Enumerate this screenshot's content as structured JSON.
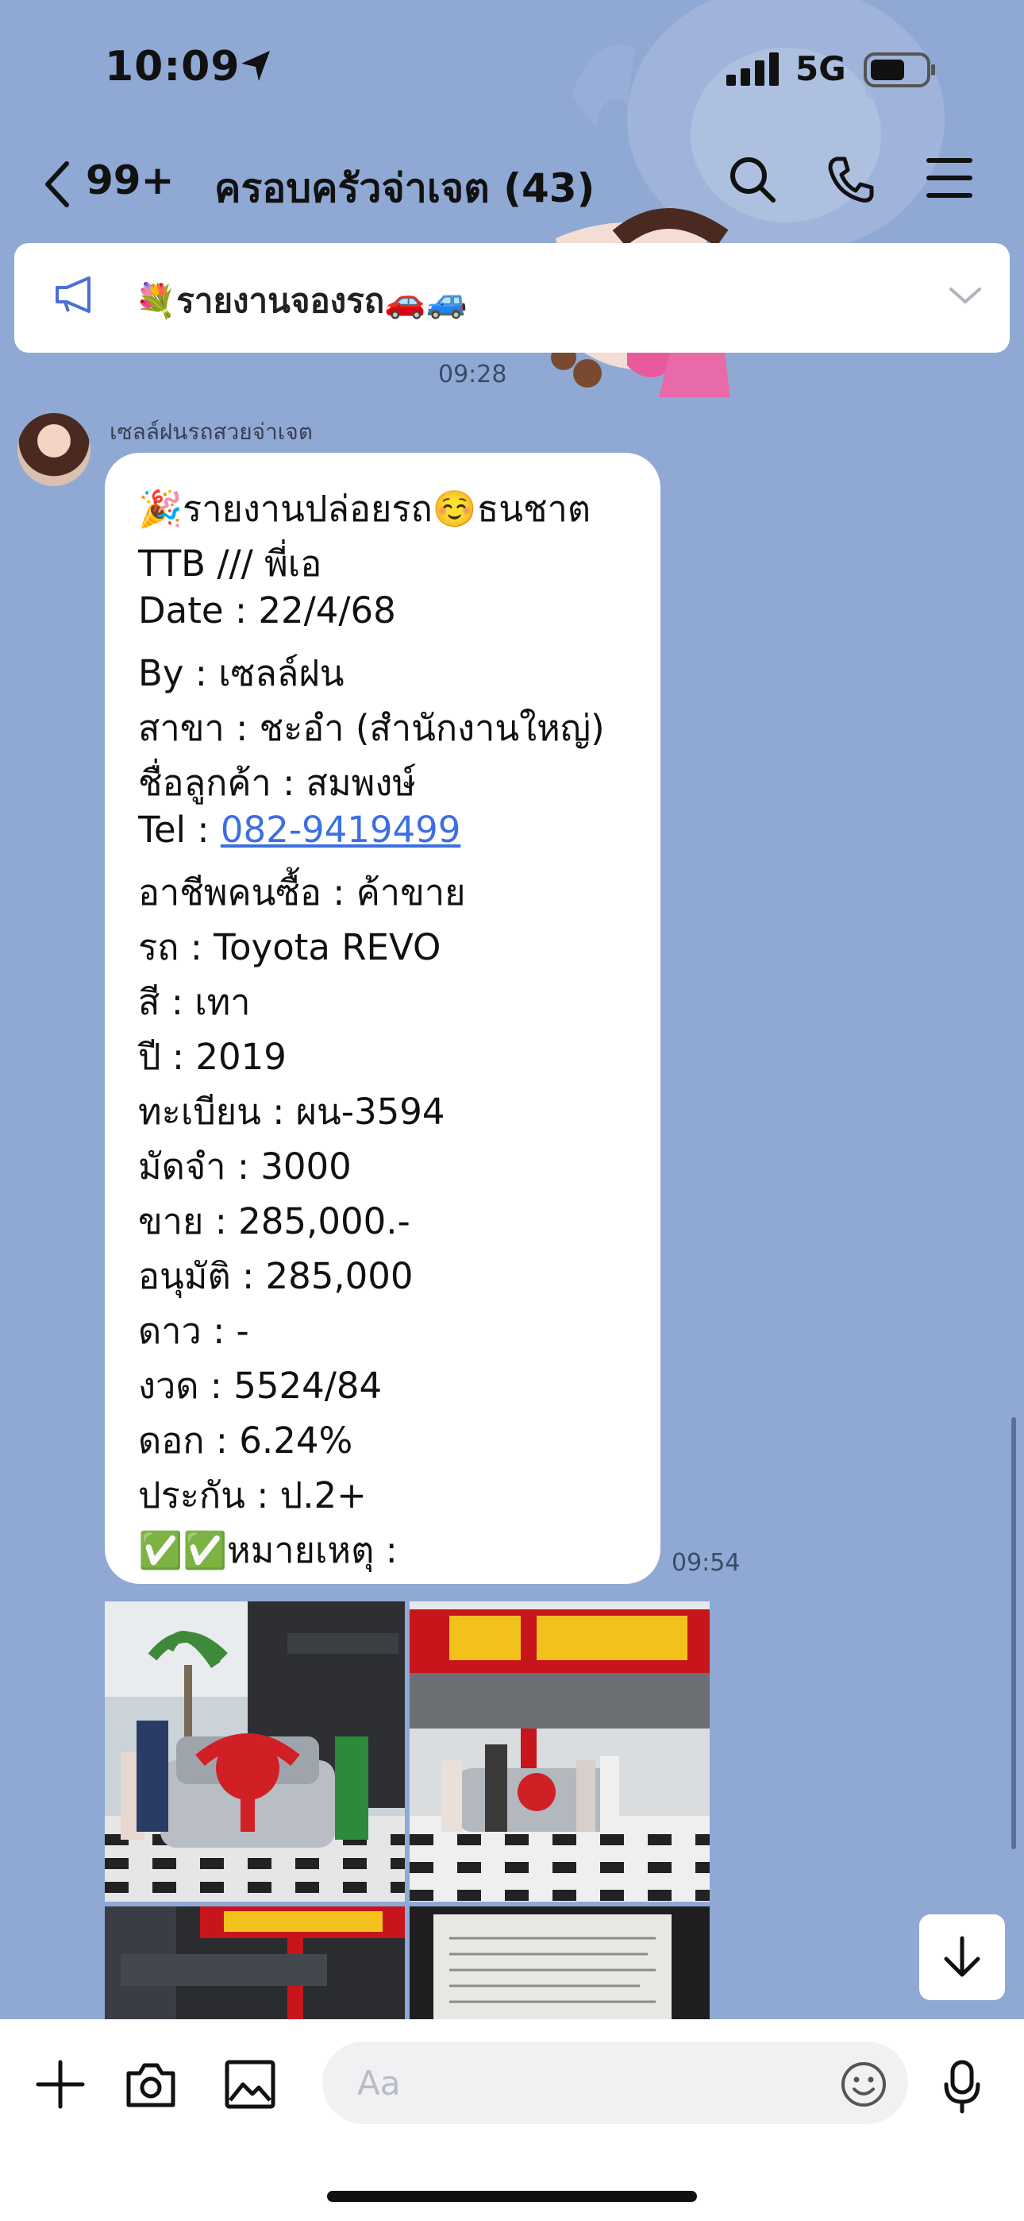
{
  "status_bar": {
    "time": "10:09",
    "network": "5G"
  },
  "nav": {
    "back_count": "99+",
    "title": "ครอบครัวจ่าเจต (43)"
  },
  "pinned_announcement": {
    "text": "💐รายงานจองรถ🚗🚙"
  },
  "timestamps": {
    "top": "09:28",
    "message": "09:54"
  },
  "message": {
    "sender": "เซลล์ฝนรถสวยจ่าเจต",
    "lines": [
      "🎉รายงานปล่อยรถ☺️ธนชาต",
      "TTB /// พี่เอ",
      "Date : 22/4/68",
      "By : เซลล์ฝน",
      "สาขา : ชะอำ (สำนักงานใหญ่)",
      "ชื่อลูกค้า : สมพงษ์",
      "Tel : ",
      "อาชีพคนซื้อ : ค้าขาย",
      "รถ : Toyota REVO",
      "สี : เทา",
      "ปี : 2019",
      "ทะเบียน : ผน-3594",
      "มัดจำ : 3000",
      "ขาย : 285,000.-",
      "อนุมัติ : 285,000",
      "ดาว : -",
      "งวด : 5524/84",
      "ดอก : 6.24%",
      "ประกัน :  ป.2+",
      "✅✅หมายเหตุ :"
    ],
    "phone_link": "082-9419499"
  },
  "composer": {
    "placeholder": "Aa"
  },
  "icons": [
    "back-icon",
    "search-icon",
    "phone-icon",
    "menu-icon",
    "megaphone-icon",
    "chevron-down-icon",
    "arrow-down-icon",
    "plus-icon",
    "camera-icon",
    "image-icon",
    "emoji-icon",
    "microphone-icon"
  ]
}
